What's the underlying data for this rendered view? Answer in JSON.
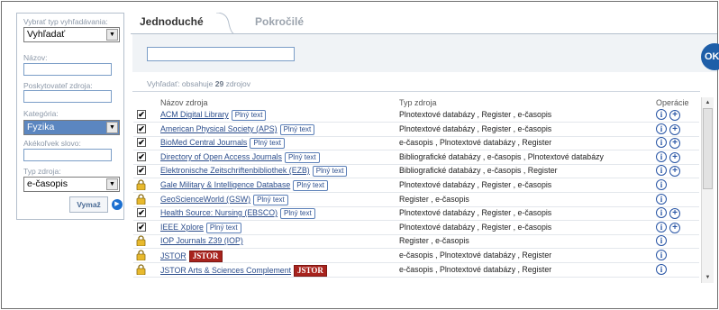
{
  "sidebar": {
    "search_type_label": "Vybrať typ vyhľadávania:",
    "search_type_value": "Vyhľadať",
    "name_label": "Názov:",
    "provider_label": "Poskytovateľ zdroja:",
    "category_label": "Kategória:",
    "category_value": "Fyzika",
    "keyword_label": "Akékoľvek slovo:",
    "source_type_label": "Typ zdroja:",
    "source_type_value": "e-časopis",
    "clear_button": "Vymaž"
  },
  "tabs": [
    {
      "label": "Jednoduché",
      "active": true
    },
    {
      "label": "Pokročilé",
      "active": false
    }
  ],
  "search": {
    "ok_label": "OK",
    "result_prefix": "Vyhľadať: obsahuje",
    "result_count": "29",
    "result_suffix": "zdrojov"
  },
  "table": {
    "headers": {
      "name": "Názov zdroja",
      "type": "Typ zdroja",
      "ops": "Operácie"
    },
    "rows": [
      {
        "name": "ACM Digital Library",
        "badge": "Plný text",
        "type": "Plnotextové databázy , Register , e-časopis",
        "lock": false,
        "plus": true
      },
      {
        "name": "American Physical Society (APS)",
        "badge": "Plný text",
        "type": "Plnotextové databázy , Register , e-časopis",
        "lock": false,
        "plus": true
      },
      {
        "name": "BioMed Central Journals",
        "badge": "Plný text",
        "type": "e-časopis , Plnotextové databázy , Register",
        "lock": false,
        "plus": true
      },
      {
        "name": "Directory of Open Access Journals",
        "badge": "Plný text",
        "type": "Bibliografické databázy , e-časopis , Plnotextové databázy",
        "lock": false,
        "plus": true
      },
      {
        "name": "Elektronische Zeitschriftenbibliothek (EZB)",
        "badge": "Plný text",
        "type": "Bibliografické databázy , e-časopis , Register",
        "lock": false,
        "plus": true
      },
      {
        "name": "Gale Military & Intelligence Database",
        "badge": "Plný text",
        "type": "Plnotextové databázy , Register , e-časopis",
        "lock": true,
        "plus": false
      },
      {
        "name": "GeoScienceWorld (GSW)",
        "badge": "Plný text",
        "type": "Register , e-časopis",
        "lock": true,
        "plus": false
      },
      {
        "name": "Health Source: Nursing (EBSCO)",
        "badge": "Plný text",
        "type": "Plnotextové databázy , Register , e-časopis",
        "lock": false,
        "plus": true
      },
      {
        "name": "IEEE Xplore",
        "badge": "Plný text",
        "type": "Plnotextové databázy , Register , e-časopis",
        "lock": false,
        "plus": true
      },
      {
        "name": "IOP Journals Z39 (IOP)",
        "badge": "",
        "type": "Register , e-časopis",
        "lock": true,
        "plus": false
      },
      {
        "name": "JSTOR",
        "badge": "",
        "jstor": "JSTOR",
        "type": "e-časopis , Plnotextové databázy , Register",
        "lock": true,
        "plus": false
      },
      {
        "name": "JSTOR Arts & Sciences Complement",
        "badge": "",
        "jstor": "JSTOR",
        "type": "e-časopis , Plnotextové databázy , Register",
        "lock": true,
        "plus": false
      }
    ]
  },
  "icons": {
    "checkbox": "check-icon",
    "lock": "lock-icon",
    "info": "info-icon",
    "add": "plus-circle-icon"
  }
}
